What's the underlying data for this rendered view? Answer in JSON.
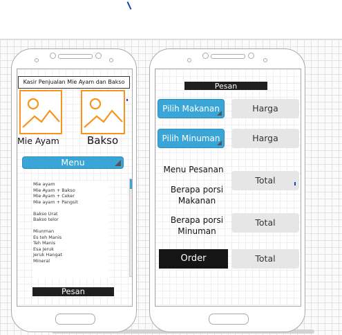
{
  "phone1": {
    "title": "Kasir Penjualan Mie Ayam dan Bakso",
    "product1_label": "Mie Ayam",
    "product2_label": "Bakso",
    "menu_button": "Menu",
    "menu_items": [
      "Mie ayam",
      "Mie Ayam + Bakso",
      "Mie Ayam + Ceker",
      "Mie ayam + Pangsit",
      "",
      "Bakso Urat",
      "Bakso telor",
      "",
      "Miunman",
      "Es teh Manis",
      "Teh Manis",
      "Esa Jeruk",
      "Jeruk Hangat",
      "Mineral"
    ],
    "order_button": "Pesan"
  },
  "phone2": {
    "header": "Pesan",
    "pick_food_button": "Pilih Makanan",
    "price_box_1": "Harga",
    "pick_drink_button": "Pilih Minuman",
    "price_box_2": "Harga",
    "order_menu_label": "Menu Pesanan",
    "total_box_1": "Total",
    "food_portion_label_line1": "Berapa porsi",
    "food_portion_label_line2": "Makanan",
    "drink_portion_label_line1": "Berapa porsi",
    "drink_portion_label_line2": "Minuman",
    "total_box_2": "Total",
    "order_button": "Order",
    "total_box_3": "Total"
  },
  "colors": {
    "accent_blue": "#3aa5d7",
    "image_placeholder_orange": "#f7941d",
    "dark_bar": "#1f1f1f",
    "gray_box": "#e6e6e6"
  },
  "icons": {
    "image_placeholder": "image-placeholder-icon",
    "dropdown_corner": "dropdown-corner-icon"
  }
}
